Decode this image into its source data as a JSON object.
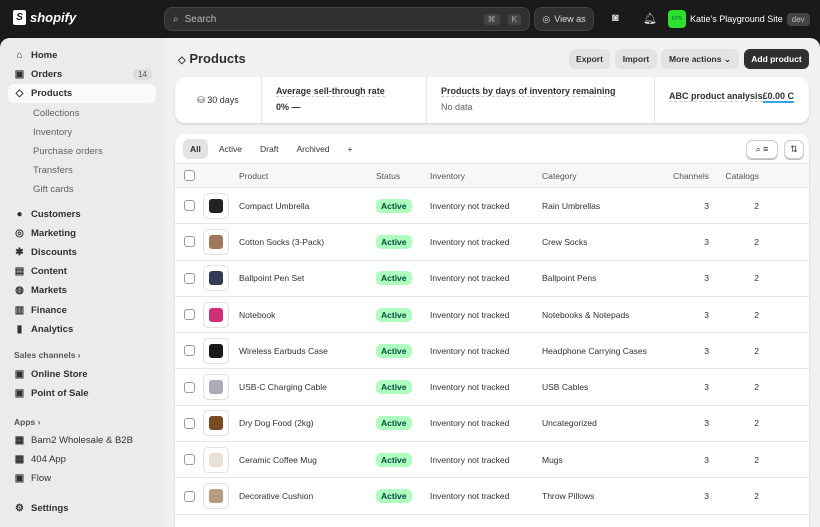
{
  "topbar": {
    "logo": "shopify",
    "search_placeholder": "Search",
    "shortcut": [
      "⌘",
      "K"
    ],
    "view_as": "View as",
    "store_initials": "KPS",
    "store_name": "Katie's Playground Site",
    "store_badge": "dev"
  },
  "sidebar": {
    "items": [
      {
        "label": "Home",
        "icon": "⌂"
      },
      {
        "label": "Orders",
        "icon": "▣",
        "badge": "14"
      },
      {
        "label": "Products",
        "icon": "◇"
      }
    ],
    "sub": [
      "Collections",
      "Inventory",
      "Purchase orders",
      "Transfers",
      "Gift cards"
    ],
    "items2": [
      {
        "label": "Customers",
        "icon": "●"
      },
      {
        "label": "Marketing",
        "icon": "◎"
      },
      {
        "label": "Discounts",
        "icon": "✱"
      },
      {
        "label": "Content",
        "icon": "▤"
      },
      {
        "label": "Markets",
        "icon": "◍"
      },
      {
        "label": "Finance",
        "icon": "▥"
      },
      {
        "label": "Analytics",
        "icon": "▮"
      }
    ],
    "sales_channels": "Sales channels",
    "channels": [
      {
        "label": "Online Store",
        "icon": "▣"
      },
      {
        "label": "Point of Sale",
        "icon": "▣"
      }
    ],
    "apps": "Apps",
    "apps_items": [
      {
        "label": "Barn2 Wholesale & B2B",
        "icon": "▦"
      },
      {
        "label": "404 App",
        "icon": "▦"
      },
      {
        "label": "Flow",
        "icon": "▣"
      }
    ],
    "settings": "Settings"
  },
  "page": {
    "title": "Products",
    "export": "Export",
    "import": "Import",
    "more_actions": "More actions",
    "add_product": "Add product"
  },
  "stats": {
    "period": "30 days",
    "s1_label": "Average sell-through rate",
    "s1_value": "0%  —",
    "s2_label": "Products by days of inventory remaining",
    "s2_value": "No data",
    "s3_label": "ABC product analysis",
    "s3_value": "£0.00 C"
  },
  "tabs": [
    "All",
    "Active",
    "Draft",
    "Archived",
    "+"
  ],
  "columns": [
    "Product",
    "Status",
    "Inventory",
    "Category",
    "Channels",
    "Catalogs"
  ],
  "rows": [
    {
      "name": "Compact Umbrella",
      "status": "Active",
      "inventory": "Inventory not tracked",
      "category": "Rain Umbrellas",
      "channels": "3",
      "catalogs": "2",
      "color": "#222"
    },
    {
      "name": "Cotton Socks (3-Pack)",
      "status": "Active",
      "inventory": "Inventory not tracked",
      "category": "Crew Socks",
      "channels": "3",
      "catalogs": "2",
      "color": "#a0775a"
    },
    {
      "name": "Ballpoint Pen Set",
      "status": "Active",
      "inventory": "Inventory not tracked",
      "category": "Ballpoint Pens",
      "channels": "3",
      "catalogs": "2",
      "color": "#333a55"
    },
    {
      "name": "Notebook",
      "status": "Active",
      "inventory": "Inventory not tracked",
      "category": "Notebooks & Notepads",
      "channels": "3",
      "catalogs": "2",
      "color": "#d0307a"
    },
    {
      "name": "Wireless Earbuds Case",
      "status": "Active",
      "inventory": "Inventory not tracked",
      "category": "Headphone Carrying Cases",
      "channels": "3",
      "catalogs": "2",
      "color": "#1a1a1a"
    },
    {
      "name": "USB-C Charging Cable",
      "status": "Active",
      "inventory": "Inventory not tracked",
      "category": "USB Cables",
      "channels": "3",
      "catalogs": "2",
      "color": "#aab"
    },
    {
      "name": "Dry Dog Food (2kg)",
      "status": "Active",
      "inventory": "Inventory not tracked",
      "category": "Uncategorized",
      "channels": "3",
      "catalogs": "2",
      "color": "#7a4a22"
    },
    {
      "name": "Ceramic Coffee Mug",
      "status": "Active",
      "inventory": "Inventory not tracked",
      "category": "Mugs",
      "channels": "3",
      "catalogs": "2",
      "color": "#e8e2d6"
    },
    {
      "name": "Decorative Cushion",
      "status": "Active",
      "inventory": "Inventory not tracked",
      "category": "Throw Pillows",
      "channels": "3",
      "catalogs": "2",
      "color": "#b89a80"
    }
  ]
}
